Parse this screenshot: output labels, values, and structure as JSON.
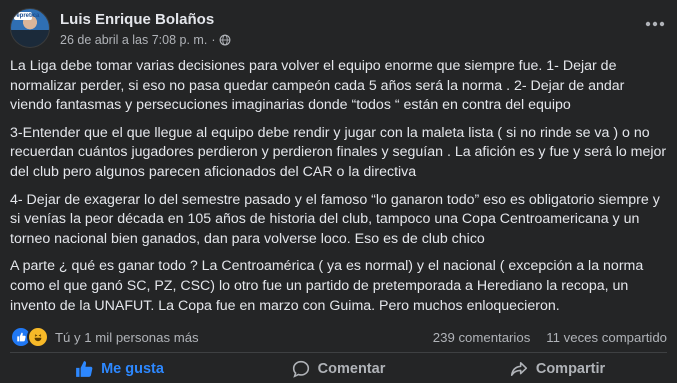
{
  "post": {
    "author": "Luis Enrique Bolaños",
    "timestamp": "26 de abril a las 7:08 p. m.",
    "separator": "·",
    "privacy_icon": "globe-icon",
    "more_icon": "ellipsis-icon",
    "avatar_badge": "repretica",
    "paragraphs": [
      "La Liga debe tomar varias decisiones para volver el equipo enorme que siempre fue. 1- Dejar de normalizar perder, si eso no pasa quedar campeón cada 5 años será la norma  . 2- Dejar de andar viendo fantasmas y persecuciones imaginarias donde “todos “ están en contra del equipo",
      "3-Entender que el que llegue al equipo debe rendir y jugar con la maleta lista ( si no rinde se va ) o no recuerdan cuántos jugadores perdieron y perdieron finales y seguían . La afición es y fue y será lo mejor del club pero algunos parecen aficionados del CAR o la directiva",
      "4- Dejar de exagerar lo del semestre  pasado y el famoso “lo ganaron todo” eso es obligatorio siempre y si venías  la peor década en 105 años de historia del club, tampoco una Copa Centroamericana y un torneo nacional bien ganados, dan para volverse loco.  Eso es de club chico",
      "A parte ¿ qué es ganar todo ? La Centroamérica ( ya es normal) y el nacional ( excepción a la norma como el que ganó SC, PZ, CSC) lo otro fue un partido de pretemporada a Herediano la recopa, un invento de la UNAFUT.  La Copa fue en marzo con Guima.  Pero  muchos enloquecieron."
    ]
  },
  "reactions": {
    "summary": "Tú y 1 mil personas más",
    "icons": [
      "like-icon",
      "haha-icon"
    ],
    "comments": "239 comentarios",
    "shares": "11 veces compartido"
  },
  "actions": {
    "like": "Me gusta",
    "comment": "Comentar",
    "share": "Compartir"
  },
  "colors": {
    "background": "#242526",
    "text": "#e4e6eb",
    "secondary": "#b0b3b8",
    "accent": "#2d88ff"
  }
}
